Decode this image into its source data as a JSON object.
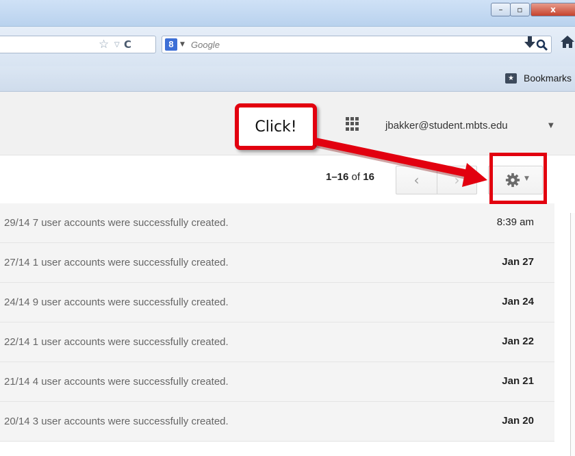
{
  "window": {
    "minimize_glyph": "–",
    "maximize_glyph": "▫",
    "close_glyph": "x"
  },
  "navbar": {
    "search_placeholder": "Google",
    "search_engine_letter": "8"
  },
  "bookmarks": {
    "label": "Bookmarks"
  },
  "header": {
    "account": "jbakker@student.mbts.edu"
  },
  "toolbar": {
    "pager_range": "1–16",
    "pager_of": "of",
    "pager_total": "16",
    "prev_glyph": "‹",
    "next_glyph": "›"
  },
  "annotation": {
    "text": "Click!",
    "color": "#e2000f"
  },
  "messages": [
    {
      "subject": "29/14 7 user accounts were successfully created.",
      "date": "8:39 am"
    },
    {
      "subject": "27/14 1 user accounts were successfully created.",
      "date": "Jan 27"
    },
    {
      "subject": "24/14 9 user accounts were successfully created.",
      "date": "Jan 24"
    },
    {
      "subject": "22/14 1 user accounts were successfully created.",
      "date": "Jan 22"
    },
    {
      "subject": "21/14 4 user accounts were successfully created.",
      "date": "Jan 21"
    },
    {
      "subject": "20/14 3 user accounts were successfully created.",
      "date": "Jan 20"
    }
  ]
}
